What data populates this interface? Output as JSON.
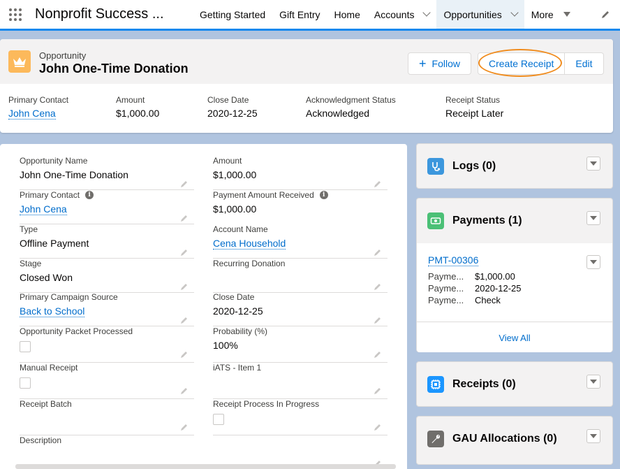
{
  "nav": {
    "app_name": "Nonprofit Success ...",
    "items": [
      {
        "label": "Getting Started"
      },
      {
        "label": "Gift Entry"
      },
      {
        "label": "Home"
      },
      {
        "label": "Accounts"
      },
      {
        "label": "Opportunities"
      },
      {
        "label": "More"
      }
    ]
  },
  "record": {
    "object_type": "Opportunity",
    "title": "John One-Time Donation",
    "buttons": {
      "follow": "Follow",
      "create_receipt": "Create Receipt",
      "edit": "Edit"
    },
    "highlights": [
      {
        "label": "Primary Contact",
        "value": "John Cena"
      },
      {
        "label": "Amount",
        "value": "$1,000.00"
      },
      {
        "label": "Close Date",
        "value": "2020-12-25"
      },
      {
        "label": "Acknowledgment Status",
        "value": "Acknowledged"
      },
      {
        "label": "Receipt Status",
        "value": "Receipt Later"
      }
    ]
  },
  "details": {
    "left": [
      {
        "label": "Opportunity Name",
        "value": "John One-Time Donation"
      },
      {
        "label": "Primary Contact",
        "value": "John Cena"
      },
      {
        "label": "Type",
        "value": "Offline Payment"
      },
      {
        "label": "Stage",
        "value": "Closed Won"
      },
      {
        "label": "Primary Campaign Source",
        "value": "Back to School"
      },
      {
        "label": "Opportunity Packet Processed",
        "value": ""
      },
      {
        "label": "Manual Receipt",
        "value": ""
      },
      {
        "label": "Receipt Batch",
        "value": ""
      },
      {
        "label": "Description",
        "value": ""
      }
    ],
    "right": [
      {
        "label": "Amount",
        "value": "$1,000.00"
      },
      {
        "label": "Payment Amount Received",
        "value": "$1,000.00"
      },
      {
        "label": "Account Name",
        "value": "Cena Household"
      },
      {
        "label": "Recurring Donation",
        "value": ""
      },
      {
        "label": "Close Date",
        "value": "2020-12-25"
      },
      {
        "label": "Probability (%)",
        "value": "100%"
      },
      {
        "label": "iATS - Item 1",
        "value": ""
      },
      {
        "label": "Receipt Process In Progress",
        "value": ""
      }
    ]
  },
  "related": {
    "logs": {
      "title": "Logs (0)",
      "icon": "stethoscope-icon",
      "color": "#3c97dd"
    },
    "payments": {
      "title": "Payments (1)",
      "icon": "money-icon",
      "color": "#4bc076",
      "record_name": "PMT-00306",
      "rows": [
        {
          "key": "Payme...",
          "value": "$1,000.00"
        },
        {
          "key": "Payme...",
          "value": "2020-12-25"
        },
        {
          "key": "Payme...",
          "value": "Check"
        }
      ],
      "view_all": "View All"
    },
    "receipts": {
      "title": "Receipts (0)",
      "icon": "chip-icon",
      "color": "#1b96ff"
    },
    "gau": {
      "title": "GAU Allocations (0)",
      "icon": "wrench-icon",
      "color": "#706e6b"
    }
  },
  "colors": {
    "accent": "#1589ee",
    "link": "#006dcc",
    "highlight_circle": "#f08c1e",
    "record_icon": "#fcb95b"
  }
}
